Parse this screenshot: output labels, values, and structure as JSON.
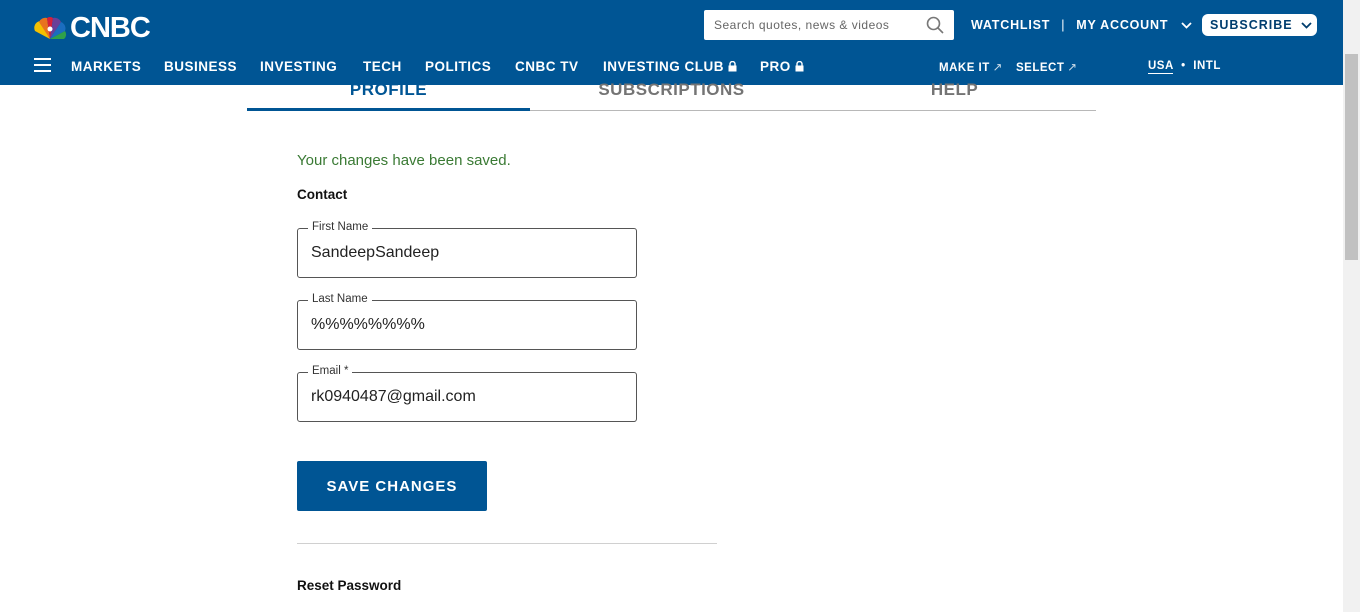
{
  "header": {
    "logo_text": "CNBC",
    "search_placeholder": "Search quotes, news & videos",
    "watchlist": "WATCHLIST",
    "separator": "|",
    "my_account": "MY ACCOUNT",
    "subscribe": "SUBSCRIBE"
  },
  "nav": {
    "items": [
      "MARKETS",
      "BUSINESS",
      "INVESTING",
      "TECH",
      "POLITICS",
      "CNBC TV",
      "INVESTING CLUB",
      "PRO"
    ],
    "make_it": "MAKE IT",
    "select": "SELECT",
    "usa": "USA",
    "dot": "•",
    "intl": "INTL"
  },
  "tabs": [
    "PROFILE",
    "SUBSCRIPTIONS",
    "HELP"
  ],
  "profile": {
    "saved_message": "Your changes have been saved.",
    "contact_heading": "Contact",
    "first_name_label": "First Name",
    "first_name_value": "SandeepSandeep",
    "last_name_label": "Last Name",
    "last_name_value": "%%%%%%%%",
    "email_label": "Email *",
    "email_value": "rk0940487@gmail.com",
    "save_button": "SAVE CHANGES",
    "reset_heading": "Reset Password"
  },
  "colors": {
    "brand_blue": "#005594",
    "success_green": "#3a7a34"
  }
}
